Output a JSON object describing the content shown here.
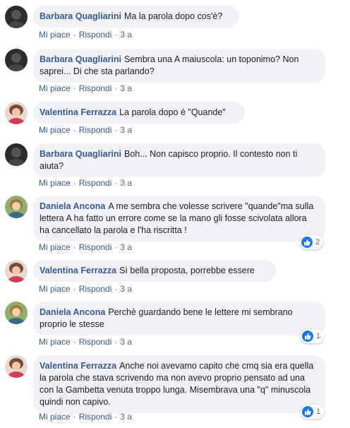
{
  "actions": {
    "like": "Mi piace",
    "reply": "Rispondi",
    "separator": "·"
  },
  "colors": {
    "author": "#385898",
    "bubble": "#f0f2f5",
    "like": "#1877f2"
  },
  "comments": [
    {
      "author": "Barbara Quagliarini",
      "text": "Ma la parola dopo cos'è?",
      "time": "3 a",
      "avatar": "avatar-dark"
    },
    {
      "author": "Barbara Quagliarini",
      "text": "Sembra una A maiuscola: un toponimo? Non saprei... Di che sta parlando?",
      "time": "3 a",
      "avatar": "avatar-dark"
    },
    {
      "author": "Valentina Ferrazza",
      "text": "La parola dopo è \"Quande\"",
      "time": "3 a",
      "avatar": "avatar-light"
    },
    {
      "author": "Barbara Quagliarini",
      "text": "Boh... Non capisco proprio. Il contesto non ti aiuta?",
      "time": "3 a",
      "avatar": "avatar-dark"
    },
    {
      "author": "Daniela Ancona",
      "text": "A me sembra che volesse scrivere \"quande\"ma sulla lettera A ha fatto un errore come se la mano gli fosse scivolata allora ha cancellato la parola e l'ha riscritta !",
      "time": "3 a",
      "avatar": "avatar-green",
      "reactions": "2"
    },
    {
      "author": "Valentina Ferrazza",
      "text": "Sì bella proposta, porrebbe essere",
      "time": "3 a",
      "avatar": "avatar-light"
    },
    {
      "author": "Daniela Ancona",
      "text": "Perchè guardando bene le lettere mi sembrano proprio le stesse",
      "time": "3 a",
      "avatar": "avatar-green",
      "reactions": "1"
    },
    {
      "author": "Valentina Ferrazza",
      "text": "Anche noi avevamo capito che cmq sia era quella la parola che stava scrivendo ma non avevo proprio pensato ad una con la Gambetta venuta troppo lunga. Misembrava una \"q\" minuscola quindi non capivo.",
      "time": "3 a",
      "avatar": "avatar-light",
      "reactions": "1"
    }
  ]
}
